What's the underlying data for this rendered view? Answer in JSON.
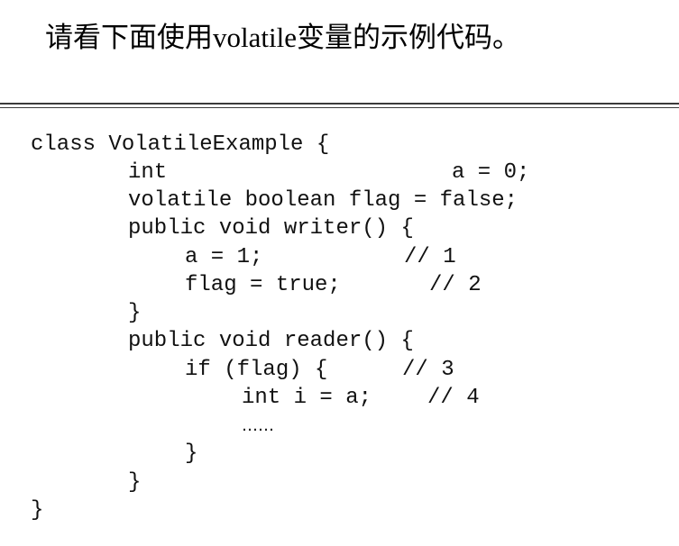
{
  "heading": {
    "prefix": "请看下面使用",
    "keyword": "volatile",
    "suffix": "变量的示例代码。"
  },
  "code": {
    "class_decl": "class VolatileExample {",
    "field_int_type": "int",
    "field_int_assign": "a = 0;",
    "field_flag": "volatile boolean flag = false;",
    "writer_sig": "public void writer() {",
    "writer_a": "a = 1;",
    "writer_a_comment": "// 1",
    "writer_flag": "flag = true;",
    "writer_flag_comment": "// 2",
    "writer_close": "}",
    "reader_sig": "public void reader() {",
    "reader_if": "if (flag) {",
    "reader_if_comment": "// 3",
    "reader_read": "int i = a;",
    "reader_read_comment": "// 4",
    "reader_ellipsis": "……",
    "if_close": "}",
    "reader_close": "}",
    "class_close": "}"
  }
}
